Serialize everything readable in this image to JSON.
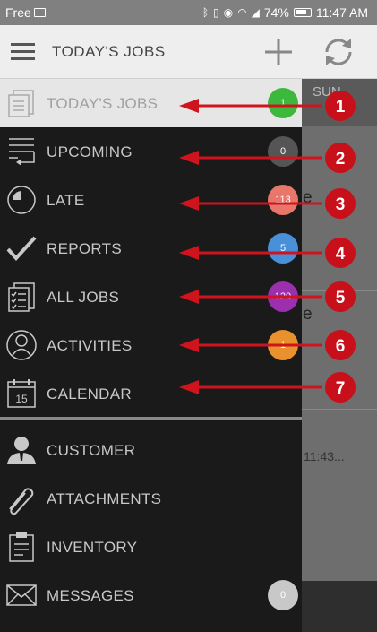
{
  "status_bar": {
    "carrier": "Free",
    "battery": "74%",
    "time": "11:47 AM",
    "icons": [
      "sim-icon",
      "bluetooth-icon",
      "vibrate-icon",
      "eye-icon",
      "wifi-icon",
      "signal-icon",
      "battery-icon"
    ]
  },
  "app_bar": {
    "title": "TODAY'S JOBS",
    "menu_icon": "hamburger-icon",
    "add_icon": "plus-icon",
    "sync_icon": "sync-icon"
  },
  "background": {
    "day_label": "SUN",
    "e1": "e",
    "e2": "e",
    "time": "11:43..."
  },
  "menu": {
    "items": [
      {
        "label": "TODAY'S JOBS",
        "icon": "todays-jobs-icon",
        "badge": "1",
        "badge_color": "#3cb93c",
        "active": true
      },
      {
        "label": "UPCOMING",
        "icon": "upcoming-icon",
        "badge": "0",
        "badge_color": "#555555"
      },
      {
        "label": "LATE",
        "icon": "late-icon",
        "badge": "113",
        "badge_color": "#e8766a"
      },
      {
        "label": "REPORTS",
        "icon": "checkmark-icon",
        "badge": "5",
        "badge_color": "#4a90d9"
      },
      {
        "label": "ALL JOBS",
        "icon": "checklist-icon",
        "badge": "120",
        "badge_color": "#9b2fae"
      },
      {
        "label": "ACTIVITIES",
        "icon": "person-circle-icon",
        "badge": "1",
        "badge_color": "#e8912d"
      },
      {
        "label": "CALENDAR",
        "icon": "calendar-icon",
        "calendar_day": "15"
      }
    ],
    "secondary": [
      {
        "label": "CUSTOMER",
        "icon": "customer-icon"
      },
      {
        "label": "ATTACHMENTS",
        "icon": "paperclip-icon"
      },
      {
        "label": "INVENTORY",
        "icon": "clipboard-icon"
      },
      {
        "label": "MESSAGES",
        "icon": "envelope-icon",
        "badge": "0",
        "badge_color": "#c8c8c8"
      }
    ]
  },
  "annotations": [
    "1",
    "2",
    "3",
    "4",
    "5",
    "6",
    "7"
  ],
  "colors": {
    "annotation": "#d0141e",
    "active_bg": "#e6e6e6",
    "drawer_bg": "#1a1a1a"
  }
}
